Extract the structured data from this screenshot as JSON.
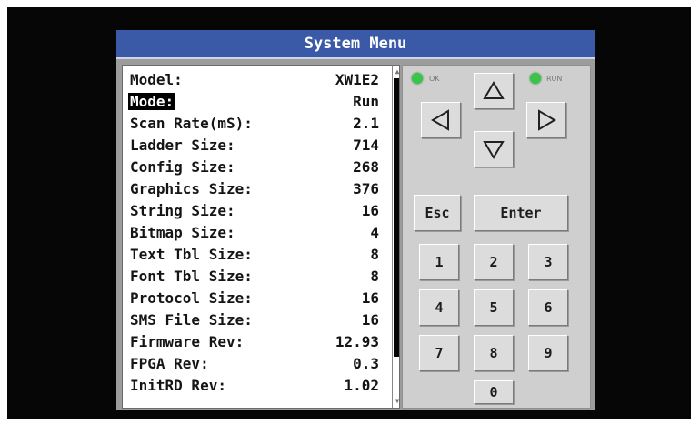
{
  "window": {
    "title": "System Menu"
  },
  "items": [
    {
      "label": "Model:",
      "value": "XW1E2"
    },
    {
      "label": "Mode:",
      "value": "Run"
    },
    {
      "label": "Scan Rate(mS):",
      "value": "2.1"
    },
    {
      "label": "Ladder Size:",
      "value": "714"
    },
    {
      "label": "Config Size:",
      "value": "268"
    },
    {
      "label": "Graphics Size:",
      "value": "376"
    },
    {
      "label": "String Size:",
      "value": "16"
    },
    {
      "label": "Bitmap Size:",
      "value": "4"
    },
    {
      "label": "Text Tbl Size:",
      "value": "8"
    },
    {
      "label": "Font Tbl Size:",
      "value": "8"
    },
    {
      "label": "Protocol Size:",
      "value": "16"
    },
    {
      "label": "SMS File Size:",
      "value": "16"
    },
    {
      "label": "Firmware Rev:",
      "value": "12.93"
    },
    {
      "label": "FPGA Rev:",
      "value": "0.3"
    },
    {
      "label": "InitRD Rev:",
      "value": "1.02"
    }
  ],
  "selected_item": "Mode:",
  "indicators": {
    "ok": {
      "label": "OK",
      "color": "#3cc34a"
    },
    "run": {
      "label": "RUN",
      "color": "#3cc34a"
    }
  },
  "keys": {
    "up_icon": "up-arrow-icon",
    "down_icon": "down-arrow-icon",
    "left_icon": "left-arrow-icon",
    "right_icon": "right-arrow-icon",
    "esc": "Esc",
    "enter": "Enter",
    "k1": "1",
    "k2": "2",
    "k3": "3",
    "k4": "4",
    "k5": "5",
    "k6": "6",
    "k7": "7",
    "k8": "8",
    "k9": "9",
    "k0": "0"
  },
  "colors": {
    "title_bar": "#3a5aa8",
    "bezel": "#060606",
    "panel": "#9c9c9c",
    "keypad": "#cfcfcf",
    "key": "#dcdcdc"
  }
}
